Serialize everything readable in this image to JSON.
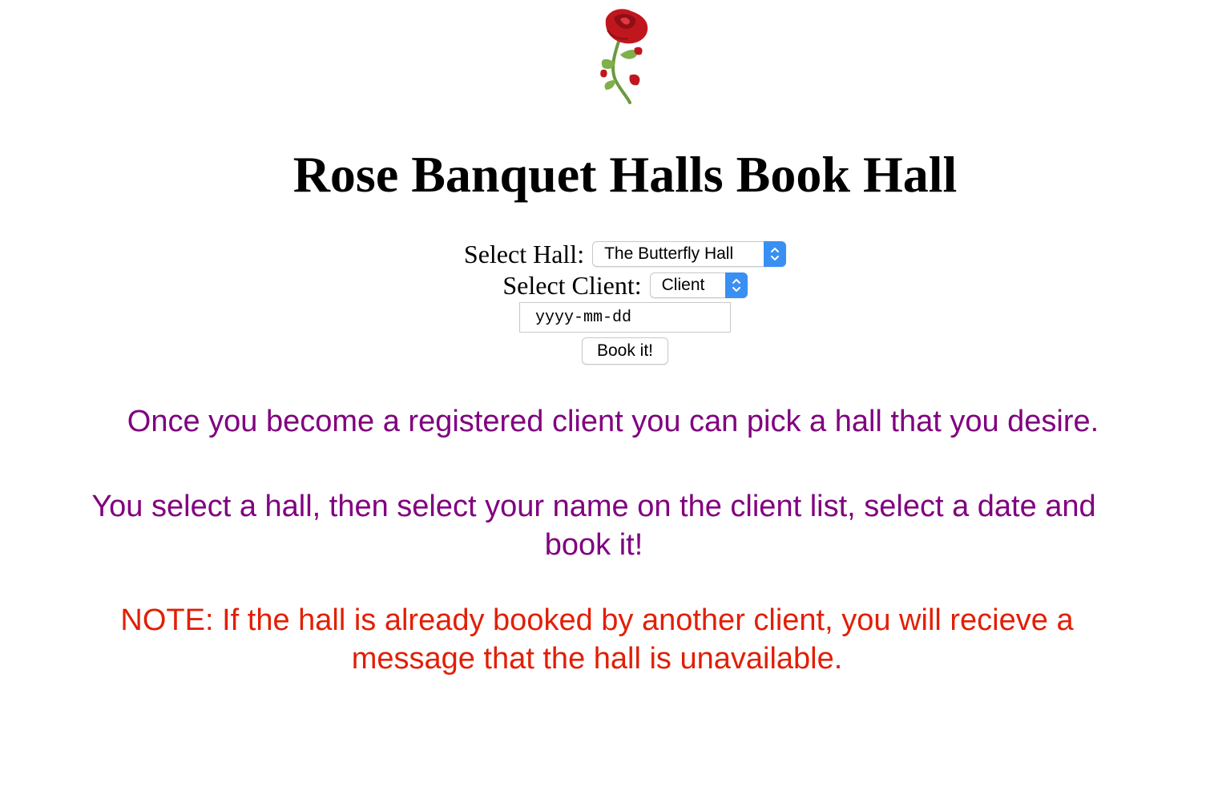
{
  "header": {
    "logo_icon": "rose-icon",
    "title": "Rose Banquet Halls Book Hall"
  },
  "form": {
    "hall_label": "Select Hall:",
    "hall_selected": "The Butterfly Hall",
    "client_label": "Select Client:",
    "client_selected": "Client",
    "date_placeholder": "yyyy-mm-dd",
    "book_button": "Book it!"
  },
  "info": {
    "line1": "Once you become a registered client you can pick a hall that you desire.",
    "line2": "You select a hall, then select your name on the client list, select a date and book it!",
    "note": "NOTE: If the hall is already booked by another client, you will recieve a message that the hall is unavailable."
  },
  "colors": {
    "info_text": "#800080",
    "note_text": "#e11f06",
    "select_accent": "#3a8ff3"
  }
}
